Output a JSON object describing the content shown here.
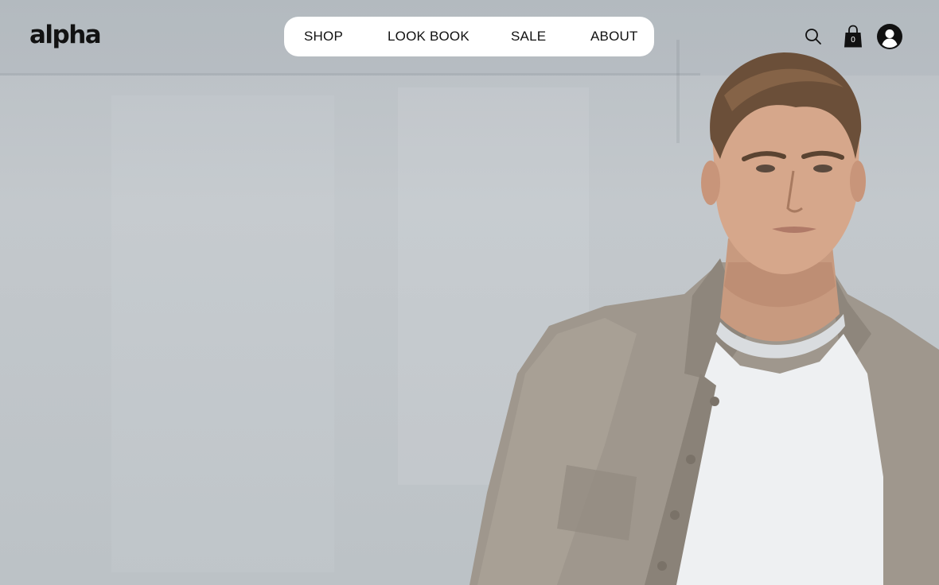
{
  "brand": {
    "logo_text": "alpha"
  },
  "nav": {
    "items": [
      {
        "label": "SHOP"
      },
      {
        "label": "LOOK BOOK"
      },
      {
        "label": "SALE"
      },
      {
        "label": "ABOUT"
      }
    ]
  },
  "header_actions": {
    "search_icon": "search-icon",
    "cart_icon": "shopping-bag-icon",
    "cart_count": "0",
    "account_icon": "user-avatar-icon"
  },
  "colors": {
    "background": "#bfc5c9",
    "text": "#111111",
    "nav_pill": "#ffffff"
  },
  "hero": {
    "image_description_icon": "model-photo"
  }
}
